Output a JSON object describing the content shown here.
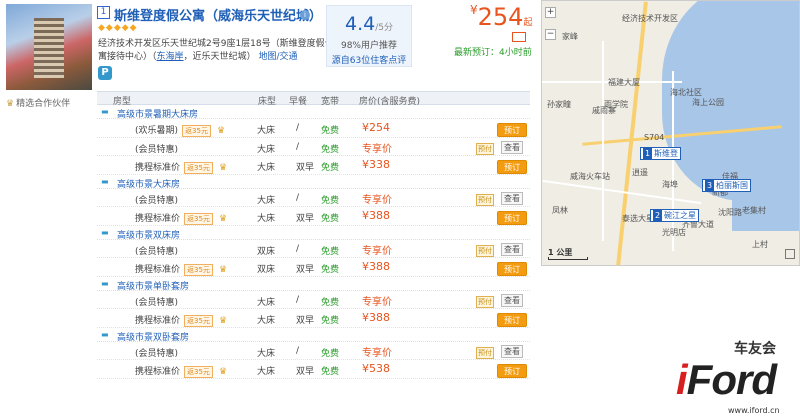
{
  "hotel": {
    "index": "1",
    "name": "斯维登度假公寓（威海乐天世纪城）",
    "info_icon": "info-icon",
    "stars": "◆◆◆◆◆",
    "address": "经济技术开发区乐天世纪城2号9座1层18号（斯维登度假公寓接待中心）",
    "nearby_link": "东海岸",
    "nearby_text": "，近乐天世纪城",
    "map_link": "地图/交通",
    "parking": "P",
    "partner": "精选合作伙伴"
  },
  "rating": {
    "score": "4.4",
    "score_max": "/5分",
    "recommend": "98%用户推荐",
    "reviews": "源自63位住客点评"
  },
  "price_summary": {
    "currency": "¥",
    "amount": "254",
    "suffix": "起",
    "latest_label": "最新预订：4小时前"
  },
  "table": {
    "headers": {
      "room_type": "房型",
      "bed": "床型",
      "breakfast": "早餐",
      "wifi": "宽带",
      "price": "房价(含服务费)"
    },
    "groups": [
      {
        "title": "高级市景暑期大床房",
        "rows": [
          {
            "name": "(欢乐暑期)",
            "rebate": "返35元",
            "bed": "大床",
            "breakfast": "/",
            "wifi": "免费",
            "price": "¥254",
            "action": "book"
          },
          {
            "name": "(会员特惠)",
            "bed": "大床",
            "breakfast": "/",
            "wifi": "免费",
            "price": "专享价",
            "action": "view"
          },
          {
            "name": "携程标准价",
            "rebate": "返35元",
            "bed": "大床",
            "breakfast": "双早",
            "wifi": "免费",
            "price": "¥338",
            "action": "book"
          }
        ]
      },
      {
        "title": "高级市景大床房",
        "rows": [
          {
            "name": "(会员特惠)",
            "bed": "大床",
            "breakfast": "/",
            "wifi": "免费",
            "price": "专享价",
            "action": "view"
          },
          {
            "name": "携程标准价",
            "rebate": "返35元",
            "bed": "大床",
            "breakfast": "双早",
            "wifi": "免费",
            "price": "¥388",
            "action": "book"
          }
        ]
      },
      {
        "title": "高级市景双床房",
        "rows": [
          {
            "name": "(会员特惠)",
            "bed": "双床",
            "breakfast": "/",
            "wifi": "免费",
            "price": "专享价",
            "action": "view"
          },
          {
            "name": "携程标准价",
            "rebate": "返35元",
            "bed": "双床",
            "breakfast": "双早",
            "wifi": "免费",
            "price": "¥388",
            "action": "book"
          }
        ]
      },
      {
        "title": "高级市景单卧套房",
        "rows": [
          {
            "name": "(会员特惠)",
            "bed": "大床",
            "breakfast": "/",
            "wifi": "免费",
            "price": "专享价",
            "action": "view"
          },
          {
            "name": "携程标准价",
            "rebate": "返35元",
            "bed": "大床",
            "breakfast": "双早",
            "wifi": "免费",
            "price": "¥388",
            "action": "book"
          }
        ]
      },
      {
        "title": "高级市景双卧套房",
        "rows": [
          {
            "name": "(会员特惠)",
            "bed": "大床",
            "breakfast": "/",
            "wifi": "免费",
            "price": "专享价",
            "action": "view"
          },
          {
            "name": "携程标准价",
            "rebate": "返35元",
            "bed": "大床",
            "breakfast": "双早",
            "wifi": "免费",
            "price": "¥538",
            "action": "book"
          }
        ]
      }
    ],
    "book_label": "预订",
    "view_label": "查看",
    "prepay_label": "预付"
  },
  "map": {
    "zoom_in": "+",
    "zoom_out": "−",
    "scale": "1 公里",
    "labels": [
      "经济技术开发区",
      "家峰",
      "福建大厦",
      "海北社区",
      "孙家疃",
      "戚雨寨",
      "雨学院",
      "海上公园",
      "S704",
      "逍遥",
      "威海火车站",
      "佳福",
      "海埠",
      "凤林",
      "齐鲁大道",
      "沈阳路",
      "泰选大星",
      "新都",
      "上村",
      "光明店",
      "老集村"
    ],
    "pins": [
      {
        "n": "1",
        "name": "斯维登"
      },
      {
        "n": "2",
        "name": "碗江之星"
      },
      {
        "n": "3",
        "name": "柏丽斯国"
      }
    ]
  },
  "watermark": {
    "club": "车友会",
    "logo_i": "i",
    "logo_rest": "Ford",
    "url": "www.iford.cn"
  }
}
